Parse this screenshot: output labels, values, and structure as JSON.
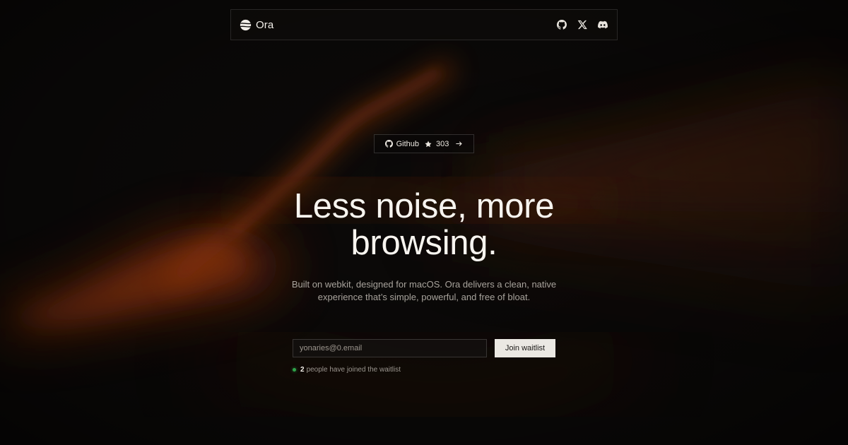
{
  "brand": {
    "name": "Ora",
    "logo_icon": "ora-logo-icon"
  },
  "nav": {
    "icons": [
      {
        "name": "github-icon"
      },
      {
        "name": "x-icon"
      },
      {
        "name": "discord-icon"
      }
    ]
  },
  "github_badge": {
    "label": "Github",
    "stars": "303",
    "star_icon": "star-icon",
    "arrow_icon": "arrow-right-icon"
  },
  "hero": {
    "title_line1": "Less noise, more",
    "title_line2": "browsing.",
    "subtitle_line1": "Built on webkit, designed for macOS. Ora delivers a clean, native",
    "subtitle_line2": "experience that’s simple, powerful, and free of bloat."
  },
  "waitlist": {
    "email_placeholder": "yonaries@0.email",
    "button_label": "Join waitlist",
    "count": "2",
    "count_suffix": "people have joined the waitlist"
  },
  "colors": {
    "background": "#0c0a09",
    "accent_glow": "#b3420f",
    "status_green": "#2fa34a",
    "button_bg": "#ebe8e3"
  }
}
